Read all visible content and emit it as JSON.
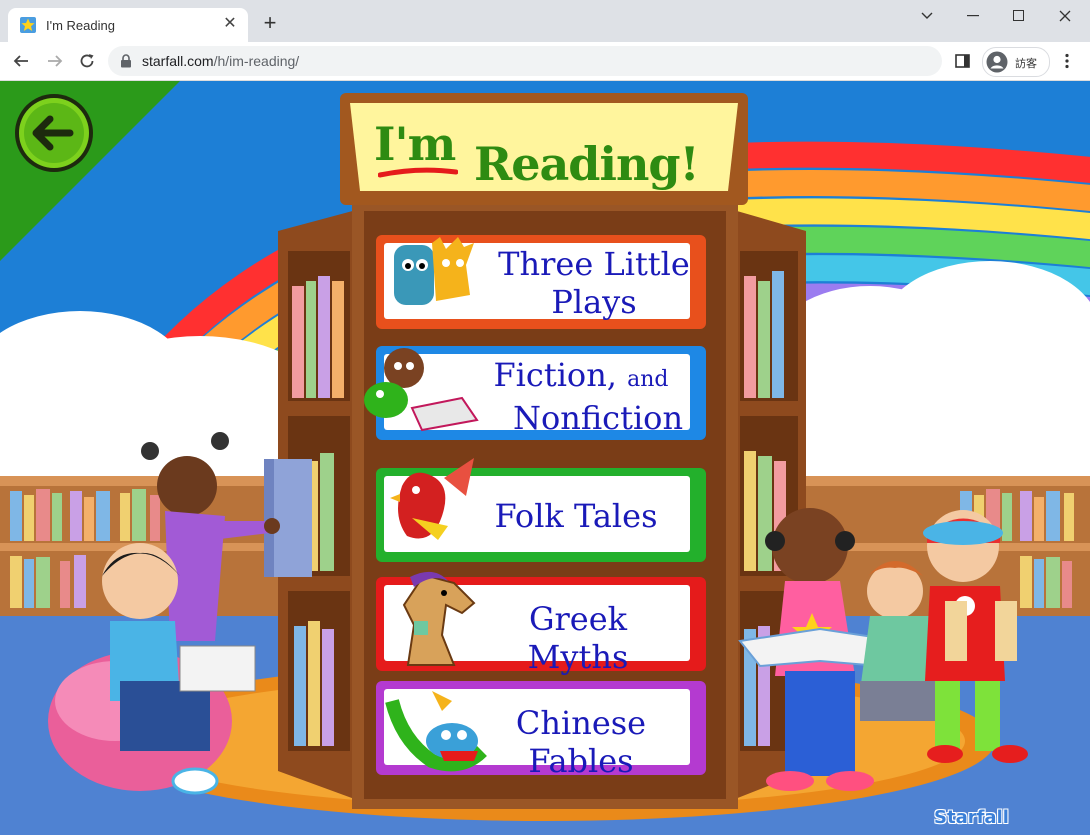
{
  "browser": {
    "tab": {
      "title": "I'm Reading",
      "close_label": "✕"
    },
    "new_tab_label": "+",
    "window_controls": {
      "minimize": "—",
      "maximize": "☐",
      "close": "✕"
    },
    "url": {
      "host": "starfall.com",
      "path": "/h/im-reading/"
    },
    "profile_label": "訪客"
  },
  "page": {
    "sign": {
      "im": "I'm",
      "reading": "Reading!"
    },
    "books": [
      {
        "line1": "Three Little",
        "line2": "Plays",
        "frame_color": "#e8501c"
      },
      {
        "line1": "Fiction,",
        "and": "and",
        "line2": "Nonfiction",
        "frame_color": "#1e88e5"
      },
      {
        "line1": "Folk Tales",
        "frame_color": "#23b02c"
      },
      {
        "line1": "Greek Myths",
        "frame_color": "#e51b1b"
      },
      {
        "line1": "Chinese Fables",
        "frame_color": "#b43ad0"
      }
    ],
    "logo": "Starfall"
  },
  "colors": {
    "sky": "#1d7fd6",
    "shelf": "#a0522d",
    "sign_bg": "#fff59d",
    "title_green": "#2e8b12",
    "book_text": "#1a1ab8"
  }
}
